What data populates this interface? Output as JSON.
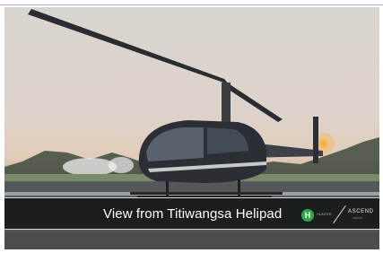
{
  "banner": {
    "caption": "View from Titiwangsa Helipad",
    "logo_h_glyph": "H",
    "logo_h_text": "HUNTER",
    "logo_ascend_text": "ASCEND",
    "logo_ascend_sub": "GROUP"
  },
  "photo": {
    "subject": "helicopter-photo-icon"
  },
  "colors": {
    "caption_bar": "#141416",
    "logo_green": "#2fa84a"
  }
}
